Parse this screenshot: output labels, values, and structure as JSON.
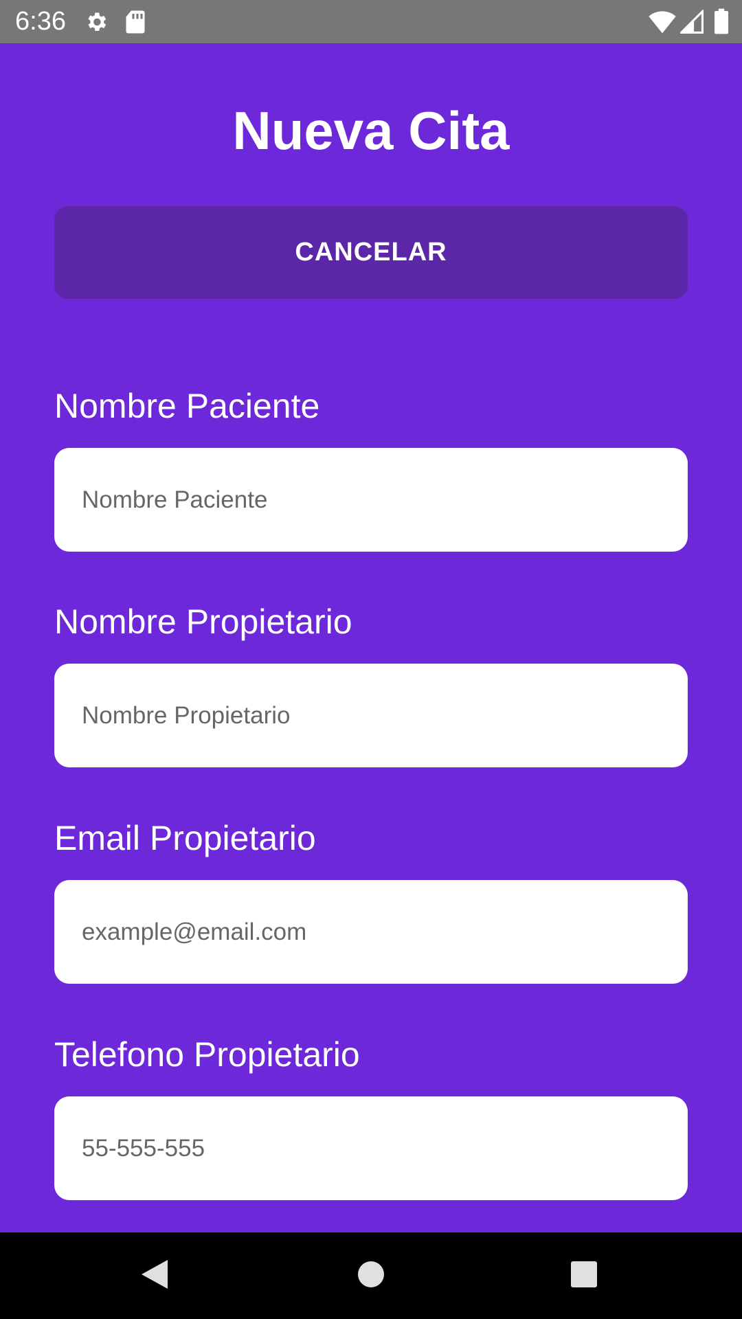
{
  "status_bar": {
    "time": "6:36",
    "icons": [
      "gear-icon",
      "sd-card-icon",
      "wifi-icon",
      "signal-icon",
      "battery-icon"
    ]
  },
  "header": {
    "title": "Nueva Cita",
    "cancel_label": "CANCELAR"
  },
  "form": {
    "fields": [
      {
        "label": "Nombre Paciente",
        "placeholder": "Nombre Paciente",
        "value": ""
      },
      {
        "label": "Nombre Propietario",
        "placeholder": "Nombre Propietario",
        "value": ""
      },
      {
        "label": "Email Propietario",
        "placeholder": "example@email.com",
        "value": ""
      },
      {
        "label": "Telefono Propietario",
        "placeholder": "55-555-555",
        "value": ""
      }
    ]
  },
  "nav_bar": {
    "buttons": [
      "back-icon",
      "home-icon",
      "recents-icon"
    ]
  },
  "colors": {
    "background": "#6d28d9",
    "cancel_button": "#5b26a8",
    "status_bar": "#777777",
    "nav_bar": "#000000",
    "input_bg": "#ffffff"
  }
}
